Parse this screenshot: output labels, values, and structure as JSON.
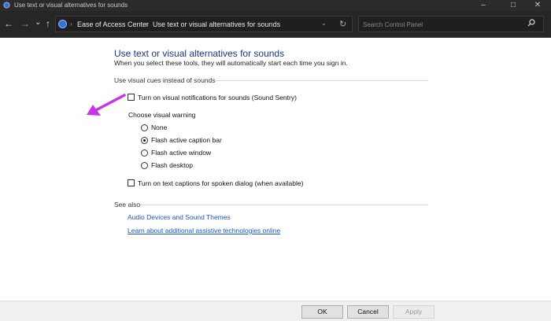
{
  "window": {
    "title": "Use text or visual alternatives for sounds"
  },
  "nav": {
    "back": "←",
    "forward": "→",
    "recent": "⌄",
    "up": "↑",
    "breadcrumb": [
      "Ease of Access Center",
      "Use text or visual alternatives for sounds"
    ],
    "crumb_separator": "›",
    "search_placeholder": "Search Control Panel"
  },
  "page": {
    "title": "Use text or visual alternatives for sounds",
    "subtitle": "When you select these tools, they will automatically start each time you sign in.",
    "visual_cues_section": "Use visual cues instead of sounds",
    "sound_sentry": {
      "label": "Turn on visual notifications for sounds (Sound Sentry)",
      "checked": false
    },
    "choose_warning_label": "Choose visual warning",
    "warnings": [
      {
        "label": "None",
        "selected": false
      },
      {
        "label": "Flash active caption bar",
        "selected": true
      },
      {
        "label": "Flash active window",
        "selected": false
      },
      {
        "label": "Flash desktop",
        "selected": false
      }
    ],
    "text_captions": {
      "label": "Turn on text captions for spoken dialog (when available)",
      "checked": false
    },
    "see_also": {
      "heading": "See also",
      "links": [
        "Audio Devices and Sound Themes",
        "Learn about additional assistive technologies online"
      ]
    }
  },
  "buttons": {
    "ok": "OK",
    "cancel": "Cancel",
    "apply": "Apply"
  },
  "colors": {
    "arrow": "#c736e6",
    "heading": "#1e3287",
    "link": "#1a55b8"
  }
}
